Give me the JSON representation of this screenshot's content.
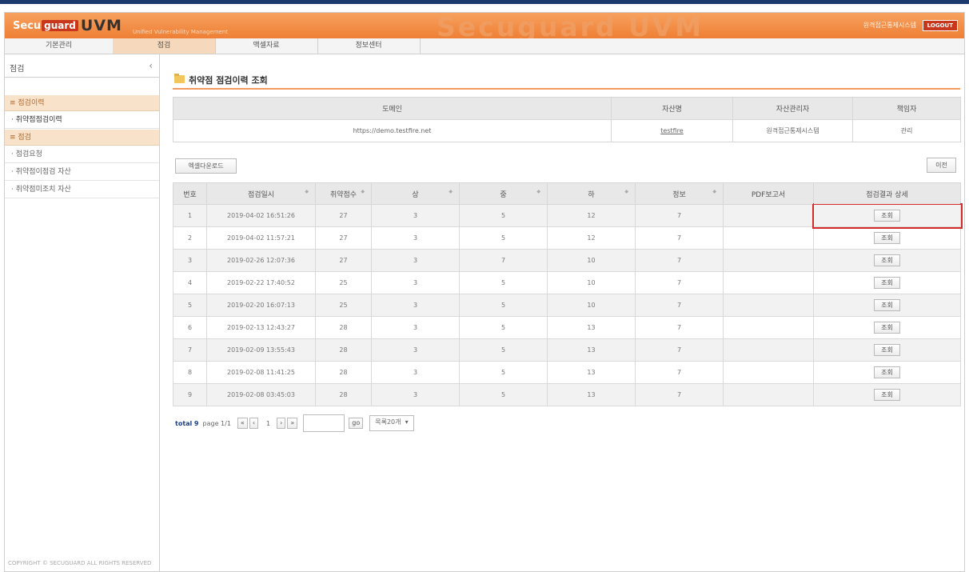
{
  "header": {
    "logo_secu": "Secu",
    "logo_guard": "guard",
    "logo_uvm": "UVM",
    "tagline": "Unified Vulnerability Management",
    "watermark": "Secuguard UVM",
    "right_text": "원격접근통제시스템",
    "logout": "LOGOUT"
  },
  "menu": [
    "기본관리",
    "점검",
    "맥셀자료",
    "정보센터"
  ],
  "sidebar": {
    "title": "점검",
    "sections": [
      {
        "label": "점검이력",
        "items": [
          "취약점점검이력"
        ]
      },
      {
        "label": "점검",
        "items": [
          "점검요청",
          "취약점이점검 자산",
          "취약점미조치 자산"
        ]
      }
    ]
  },
  "page_title": "취약점 점검이력 조회",
  "site_table": {
    "headers": [
      "도메인",
      "자산명",
      "자산관리자",
      "책임자"
    ],
    "row": [
      "https://demo.testfire.net",
      "testfire",
      "원격접근통제시스템",
      "관리"
    ]
  },
  "buttons": {
    "excel": "엑셀다운로드",
    "prev": "이전",
    "view": "조회",
    "go": "go"
  },
  "history": {
    "headers": [
      "번호",
      "점검일시",
      "취약점수",
      "상",
      "중",
      "하",
      "정보",
      "PDF보고서",
      "점검결과 상세"
    ],
    "rows": [
      [
        "1",
        "2019-04-02 16:51:26",
        "27",
        "3",
        "5",
        "12",
        "7",
        ""
      ],
      [
        "2",
        "2019-04-02 11:57:21",
        "27",
        "3",
        "5",
        "12",
        "7",
        ""
      ],
      [
        "3",
        "2019-02-26 12:07:36",
        "27",
        "3",
        "7",
        "10",
        "7",
        ""
      ],
      [
        "4",
        "2019-02-22 17:40:52",
        "25",
        "3",
        "5",
        "10",
        "7",
        ""
      ],
      [
        "5",
        "2019-02-20 16:07:13",
        "25",
        "3",
        "5",
        "10",
        "7",
        ""
      ],
      [
        "6",
        "2019-02-13 12:43:27",
        "28",
        "3",
        "5",
        "13",
        "7",
        ""
      ],
      [
        "7",
        "2019-02-09 13:55:43",
        "28",
        "3",
        "5",
        "13",
        "7",
        ""
      ],
      [
        "8",
        "2019-02-08 11:41:25",
        "28",
        "3",
        "5",
        "13",
        "7",
        ""
      ],
      [
        "9",
        "2019-02-08 03:45:03",
        "28",
        "3",
        "5",
        "13",
        "7",
        ""
      ]
    ],
    "highlighted_row": 0
  },
  "pager": {
    "total_label": "total",
    "total_count": "9",
    "page_label": "page",
    "page_value": "1/1",
    "first": "«",
    "prev": "‹",
    "current": "1",
    "next": "›",
    "last": "»",
    "per_page": "목록20개"
  },
  "footer": "COPYRIGHT © SECUGUARD ALL RIGHTS RESERVED"
}
